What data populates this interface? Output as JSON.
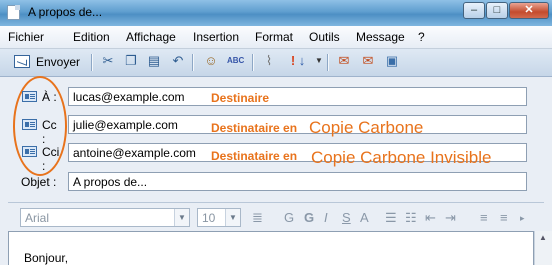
{
  "window": {
    "title": "A propos de...",
    "controls": {
      "minimize": "–",
      "maximize": "□",
      "close": "✕"
    }
  },
  "menu": [
    "Fichier",
    "Edition",
    "Affichage",
    "Insertion",
    "Format",
    "Outils",
    "Message",
    "?"
  ],
  "toolbar": {
    "send_label": "Envoyer",
    "icons": [
      "cut-icon",
      "copy-icon",
      "paste-icon",
      "undo-icon",
      "check-names-icon",
      "spelling-icon",
      "attach-icon",
      "priority-icon",
      "dropdown-icon",
      "sign-icon",
      "encrypt-icon",
      "offline-icon"
    ]
  },
  "header": {
    "to": {
      "label": "À :",
      "value": "lucas@example.com",
      "annotation": "Destinaire"
    },
    "cc": {
      "label": "Cc :",
      "value": "julie@example.com",
      "annotation": "Destinataire en",
      "annotation_big": "Copie Carbone"
    },
    "bcc": {
      "label": "Cci :",
      "value": "antoine@example.com",
      "annotation": "Destinataire en",
      "annotation_big": "Copie Carbone Invisible"
    },
    "subject": {
      "label": "Objet :",
      "value": "A propos de..."
    }
  },
  "format": {
    "font": "Arial",
    "size": "10"
  },
  "body": {
    "text": "Bonjour,"
  },
  "colors": {
    "annotation": "#e8731c",
    "titlebar": "#5f9ecf"
  }
}
